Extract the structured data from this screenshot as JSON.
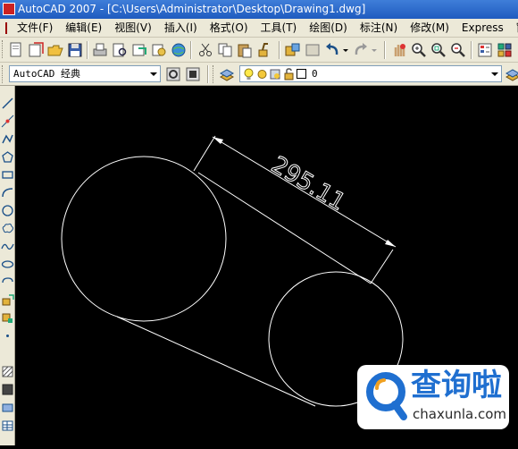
{
  "window": {
    "title": "AutoCAD 2007 - [C:\\Users\\Administrator\\Desktop\\Drawing1.dwg]"
  },
  "menu": {
    "items": [
      "文件(F)",
      "编辑(E)",
      "视图(V)",
      "插入(I)",
      "格式(O)",
      "工具(T)",
      "绘图(D)",
      "标注(N)",
      "修改(M)",
      "Express",
      "窗口"
    ]
  },
  "toolbar2": {
    "workspace": "AutoCAD 经典",
    "layer": "0"
  },
  "drawing": {
    "dimension_text": "295.11",
    "line_color": "#ffffff",
    "background": "#000000"
  },
  "watermark": {
    "title": "查询啦",
    "url": "chaxunla.com",
    "color": "#1f6fd0"
  }
}
